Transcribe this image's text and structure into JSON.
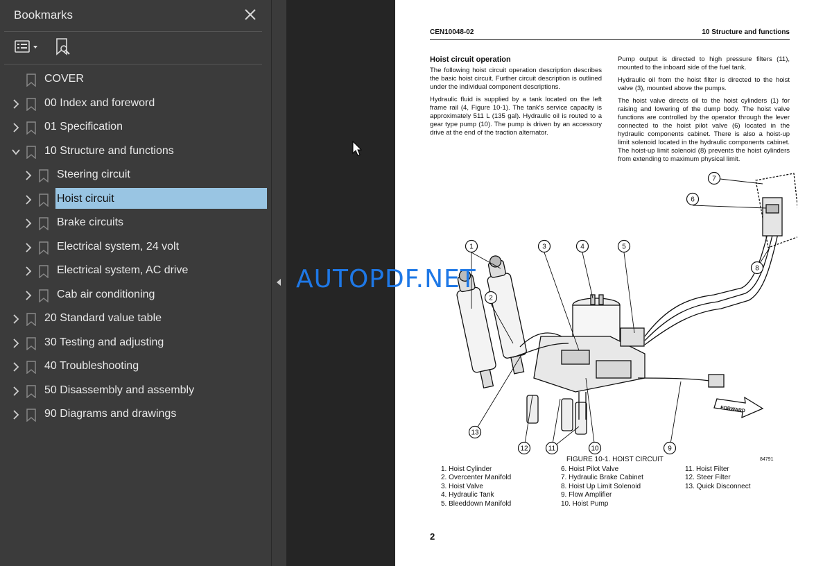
{
  "sidebar": {
    "title": "Bookmarks",
    "items": [
      {
        "label": "COVER",
        "level": 0,
        "expandable": false,
        "expanded": false,
        "selected": false
      },
      {
        "label": "00 Index and foreword",
        "level": 0,
        "expandable": true,
        "expanded": false,
        "selected": false
      },
      {
        "label": "01 Specification",
        "level": 0,
        "expandable": true,
        "expanded": false,
        "selected": false
      },
      {
        "label": "10 Structure and functions",
        "level": 0,
        "expandable": true,
        "expanded": true,
        "selected": false
      },
      {
        "label": "Steering circuit",
        "level": 1,
        "expandable": true,
        "expanded": false,
        "selected": false
      },
      {
        "label": "Hoist circuit",
        "level": 1,
        "expandable": true,
        "expanded": false,
        "selected": true
      },
      {
        "label": "Brake circuits",
        "level": 1,
        "expandable": true,
        "expanded": false,
        "selected": false
      },
      {
        "label": "Electrical system, 24 volt",
        "level": 1,
        "expandable": true,
        "expanded": false,
        "selected": false
      },
      {
        "label": "Electrical system, AC drive",
        "level": 1,
        "expandable": true,
        "expanded": false,
        "selected": false
      },
      {
        "label": "Cab air conditioning",
        "level": 1,
        "expandable": true,
        "expanded": false,
        "selected": false
      },
      {
        "label": "20 Standard value table",
        "level": 0,
        "expandable": true,
        "expanded": false,
        "selected": false
      },
      {
        "label": "30 Testing and adjusting",
        "level": 0,
        "expandable": true,
        "expanded": false,
        "selected": false
      },
      {
        "label": "40 Troubleshooting",
        "level": 0,
        "expandable": true,
        "expanded": false,
        "selected": false
      },
      {
        "label": "50 Disassembly and assembly",
        "level": 0,
        "expandable": true,
        "expanded": false,
        "selected": false
      },
      {
        "label": "90 Diagrams and drawings",
        "level": 0,
        "expandable": true,
        "expanded": false,
        "selected": false
      }
    ]
  },
  "page": {
    "header_left": "CEN10048-02",
    "header_right": "10 Structure and functions",
    "section_title": "Hoist circuit operation",
    "left_paragraphs": [
      "The following hoist circuit operation description describes the basic hoist circuit. Further circuit description is outlined under the individual component descriptions.",
      "Hydraulic fluid is supplied by a tank located on the left frame rail (4, Figure 10-1). The tank's service capacity is approximately 511 L (135 gal). Hydraulic oil is routed to a gear type pump (10). The pump is driven by an accessory drive at the end of the traction alternator."
    ],
    "right_paragraphs": [
      "Pump output is directed to high pressure filters (11), mounted to the inboard side of the fuel tank.",
      "Hydraulic oil from the hoist filter is directed to the hoist valve (3), mounted above the pumps.",
      "The hoist valve directs oil to the hoist cylinders (1) for raising and lowering of the dump body. The hoist valve functions are controlled by the operator through the lever connected to the hoist pilot valve (6) located in the hydraulic components cabinet. There is also a hoist-up limit solenoid located in the hydraulic components cabinet. The hoist-up limit solenoid (8) prevents the hoist cylinders from extending to maximum physical limit."
    ],
    "figure_caption": "FIGURE 10-1. HOIST CIRCUIT",
    "figure_number": "84791",
    "forward_label": "FORWARD",
    "callouts": [
      "1",
      "2",
      "3",
      "4",
      "5",
      "6",
      "7",
      "8",
      "9",
      "10",
      "11",
      "12",
      "13"
    ],
    "legend_col1": [
      "1. Hoist Cylinder",
      "2. Overcenter Manifold",
      "3. Hoist Valve",
      "4. Hydraulic Tank",
      "5. Bleeddown Manifold"
    ],
    "legend_col2": [
      "6. Hoist Pilot Valve",
      "7. Hydraulic Brake Cabinet",
      "8. Hoist Up Limit Solenoid",
      "9. Flow Amplifier",
      "10. Hoist Pump"
    ],
    "legend_col3": [
      "11. Hoist Filter",
      "12. Steer Filter",
      "13. Quick Disconnect"
    ],
    "page_number": "2"
  },
  "watermark": "AUTOPDF.NET",
  "colors": {
    "sidebar_bg": "#3b3b3b",
    "selected_bg": "#99c5e3",
    "viewer_bg": "#252525",
    "watermark": "#1e78e6"
  },
  "icons": {
    "close": "close-icon",
    "options": "list-options-icon",
    "find_bookmark": "find-bookmark-icon",
    "bookmark": "bookmark-icon",
    "expand": "chevron-right-icon",
    "collapse": "chevron-down-icon"
  }
}
